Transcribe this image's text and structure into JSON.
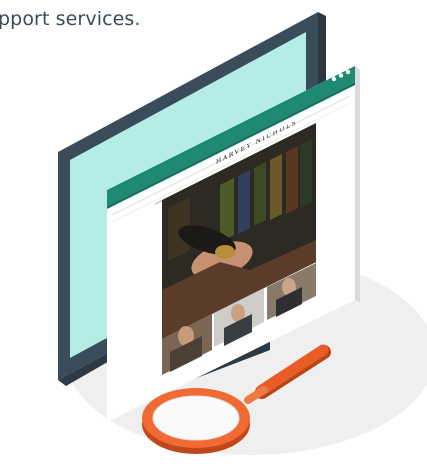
{
  "caption": "pport services.",
  "website": {
    "brand": "HARVEY NICHOLS"
  },
  "colors": {
    "monitor_frame": "#3a4c59",
    "monitor_screen": "#b4ede6",
    "browser_chrome": "#1f8a72",
    "magnifier_lens": "#f26a33",
    "magnifier_handle": "#e85c25",
    "floor_shadow": "#efefef"
  },
  "icons": [
    "browser-window-dots-icon",
    "magnifying-glass-icon"
  ]
}
